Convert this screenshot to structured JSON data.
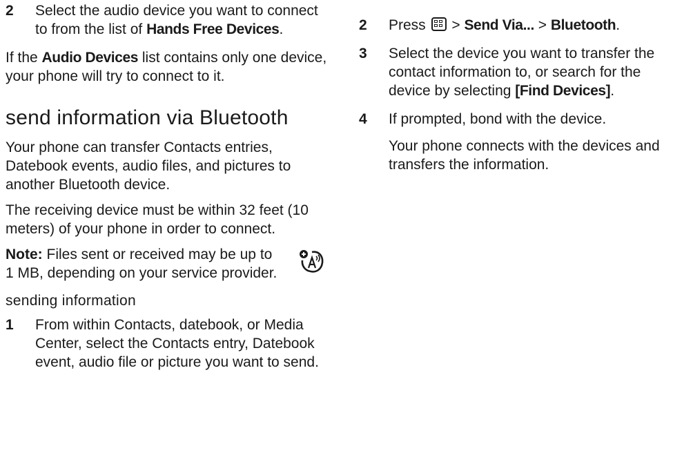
{
  "left": {
    "step2": {
      "num": "2",
      "text_pre": "Select the audio device you want to connect to from the list of ",
      "menu": "Hands Free Devices",
      "text_post": "."
    },
    "para1": {
      "pre": "If the ",
      "menu": "Audio Devices",
      "post": " list contains only one device, your phone will try to connect to it."
    },
    "heading": "send information via Bluetooth",
    "para2": "Your phone can transfer Contacts entries, Datebook events, audio files, and pictures to another Bluetooth device.",
    "para3": "The receiving device must be within 32 feet (10 meters) of your phone in order to connect.",
    "note": {
      "label": "Note:",
      "text": " Files sent or received may be up to 1 MB, depending on your service provider."
    },
    "subheading": "sending information",
    "step1": {
      "num": "1",
      "text": "From within Contacts, datebook, or Media Center, select the Contacts entry, Datebook event, audio file or picture you want to send."
    }
  },
  "right": {
    "step2": {
      "num": "2",
      "pre": "Press ",
      "sep1": " > ",
      "menu1": "Send Via...",
      "sep2": " > ",
      "menu2": "Bluetooth",
      "post": "."
    },
    "step3": {
      "num": "3",
      "text": "Select the device you want to transfer the contact information to, or search for the device by selecting ",
      "menu": "[Find Devices]",
      "post": "."
    },
    "step4": {
      "num": "4",
      "text": "If prompted, bond with the device."
    },
    "para": "Your phone connects with the devices and transfers the information."
  }
}
